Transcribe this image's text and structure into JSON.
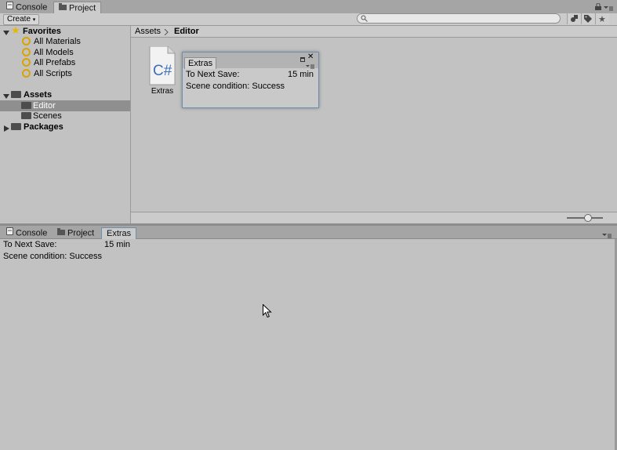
{
  "top_tabs": [
    {
      "label": "Console",
      "icon": "console-icon",
      "active": false
    },
    {
      "label": "Project",
      "icon": "folder-icon",
      "active": true
    }
  ],
  "toolbar": {
    "create_label": "Create",
    "search_value": ""
  },
  "tree": {
    "favorites_label": "Favorites",
    "favorites_items": [
      "All Materials",
      "All Models",
      "All Prefabs",
      "All Scripts"
    ],
    "assets_label": "Assets",
    "assets_children": [
      "Editor",
      "Scenes"
    ],
    "packages_label": "Packages",
    "selected": "Editor"
  },
  "breadcrumb": {
    "root": "Assets",
    "current": "Editor"
  },
  "file": {
    "name": "Extras",
    "glyph": "C#"
  },
  "float_window": {
    "tab_label": "Extras",
    "next_save_label": "To Next Save:",
    "next_save_value": "15 min",
    "scene_condition": "Scene condition: Success"
  },
  "bottom_tabs": [
    {
      "label": "Console",
      "icon": "console-icon",
      "active": false
    },
    {
      "label": "Project",
      "icon": "folder-icon",
      "active": false
    },
    {
      "label": "Extras",
      "icon": "",
      "active": true
    }
  ],
  "lower_panel": {
    "next_save_label": "To Next Save:",
    "next_save_value": "15 min",
    "scene_condition": "Scene condition: Success"
  },
  "colors": {
    "accent": "#6e8fb0",
    "selection": "#8f8f8f",
    "csharp": "#3d6fb6",
    "star": "#e6b800"
  }
}
